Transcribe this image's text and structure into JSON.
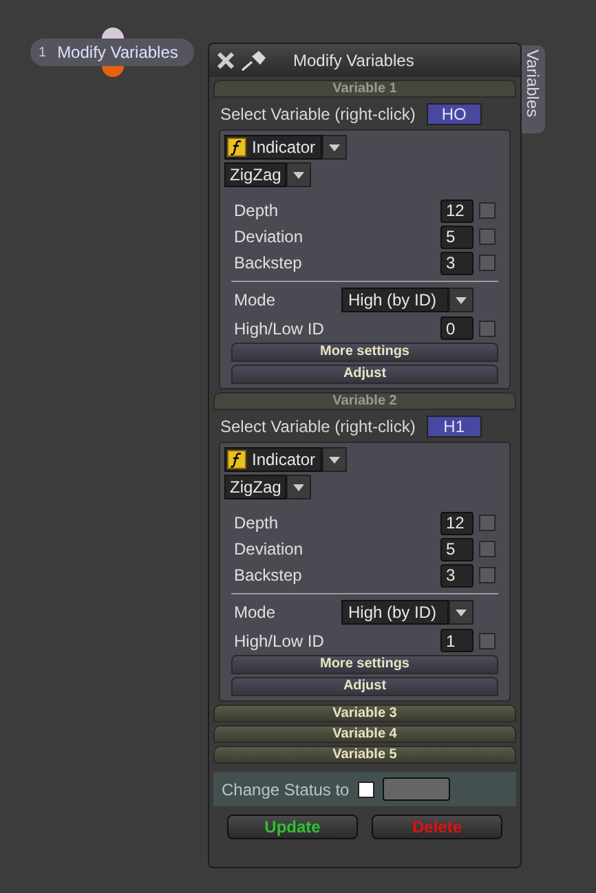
{
  "node": {
    "number": "1",
    "label": "Modify Variables"
  },
  "window": {
    "title": "Modify Variables",
    "side_tab": "Variables"
  },
  "variables": [
    {
      "header": "Variable 1",
      "expanded": true,
      "select_label": "Select Variable (right-click)",
      "variable_name": "HO",
      "source": "Indicator",
      "indicator": "ZigZag",
      "params": [
        {
          "label": "Depth",
          "value": "12",
          "checked": false
        },
        {
          "label": "Deviation",
          "value": "5",
          "checked": false
        },
        {
          "label": "Backstep",
          "value": "3",
          "checked": false
        }
      ],
      "mode_label": "Mode",
      "mode": "High (by ID)",
      "id_label": "High/Low ID",
      "id_value": "0",
      "id_checked": false,
      "more_settings": "More settings",
      "adjust": "Adjust"
    },
    {
      "header": "Variable 2",
      "expanded": true,
      "select_label": "Select Variable (right-click)",
      "variable_name": "H1",
      "source": "Indicator",
      "indicator": "ZigZag",
      "params": [
        {
          "label": "Depth",
          "value": "12",
          "checked": false
        },
        {
          "label": "Deviation",
          "value": "5",
          "checked": false
        },
        {
          "label": "Backstep",
          "value": "3",
          "checked": false
        }
      ],
      "mode_label": "Mode",
      "mode": "High (by ID)",
      "id_label": "High/Low ID",
      "id_value": "1",
      "id_checked": false,
      "more_settings": "More settings",
      "adjust": "Adjust"
    },
    {
      "header": "Variable 3",
      "expanded": false
    },
    {
      "header": "Variable 4",
      "expanded": false
    },
    {
      "header": "Variable 5",
      "expanded": false
    }
  ],
  "status": {
    "label": "Change Status to",
    "checked": false
  },
  "buttons": [
    {
      "label": "Update",
      "kind": "update"
    },
    {
      "label": "Delete",
      "kind": "delete"
    }
  ]
}
